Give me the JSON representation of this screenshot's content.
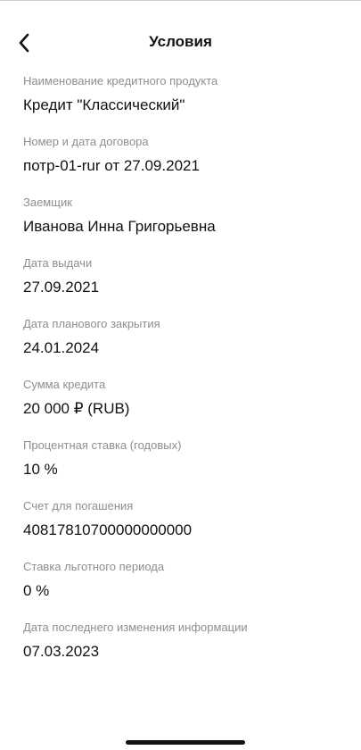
{
  "header": {
    "title": "Условия",
    "back_icon": "chevron-left-icon"
  },
  "fields": [
    {
      "label": "Наименование кредитного продукта",
      "value": "Кредит \"Классический\""
    },
    {
      "label": "Номер и дата договора",
      "value": "потр-01-rur от 27.09.2021"
    },
    {
      "label": "Заемщик",
      "value": "Иванова Инна Григорьевна"
    },
    {
      "label": "Дата выдачи",
      "value": "27.09.2021"
    },
    {
      "label": "Дата планового закрытия",
      "value": "24.01.2024"
    },
    {
      "label": "Сумма кредита",
      "value": "20 000 ₽ (RUB)"
    },
    {
      "label": "Процентная ставка (годовых)",
      "value": "10 %"
    },
    {
      "label": "Счет для погашения",
      "value": "40817810700000000000"
    },
    {
      "label": "Ставка льготного периода",
      "value": "0 %"
    },
    {
      "label": "Дата последнего изменения информации",
      "value": "07.03.2023"
    }
  ],
  "colors": {
    "label": "#8e8e93",
    "value": "#111111",
    "background": "#ffffff"
  }
}
